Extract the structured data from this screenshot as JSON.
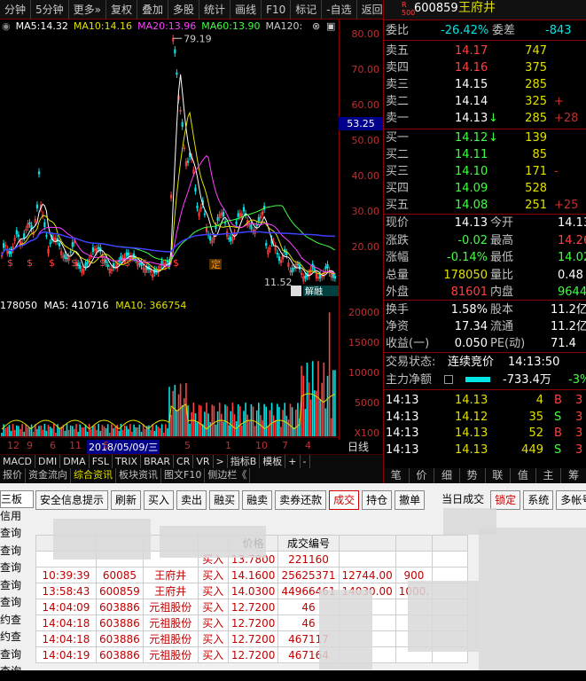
{
  "toolbar": [
    "分钟",
    "5分钟",
    "更多»",
    "复权",
    "叠加",
    "多股",
    "统计",
    "画线",
    "F10",
    "标记",
    "-自选",
    "返回"
  ],
  "ma": [
    {
      "label": "MA5:",
      "value": "14.32",
      "color": "#ffffff"
    },
    {
      "label": "MA10:",
      "value": "14.16",
      "color": "#e0e000"
    },
    {
      "label": "MA20:",
      "value": "13.96",
      "color": "#ff40ff"
    },
    {
      "label": "MA60:",
      "value": "13.90",
      "color": "#40ff40"
    },
    {
      "label": "MA120:",
      "value": "",
      "color": "#cccccc"
    }
  ],
  "price_axis": [
    "80.00",
    "70.00",
    "60.00",
    "50.00",
    "40.00",
    "30.00",
    "20.00"
  ],
  "cursor_price": "53.25",
  "annotations": {
    "high": "79.19",
    "low": "11.52",
    "ding": "定",
    "jiejin": "解",
    "rong": "融"
  },
  "volume_row": {
    "prefix": "178050",
    "ma5": "MA5: 410716",
    "ma10": "MA10: 366754"
  },
  "vol_axis": [
    "20000",
    "15000",
    "10000",
    "5000",
    "X100"
  ],
  "dates": [
    "12",
    "9",
    "6",
    "11",
    "2018/05/09/三",
    "6",
    "5",
    "1",
    "10",
    "7",
    "4"
  ],
  "date_label": "日线",
  "indicator_tabs": [
    "MACD",
    "DMI",
    "DMA",
    "FSL",
    "TRIX",
    "BRAR",
    "CR",
    "VR",
    ">",
    "指标B",
    "模板",
    "+",
    "-"
  ],
  "lower_tabs": [
    "报价",
    "资金流向",
    "综合资讯",
    "板块资讯",
    "图文F10",
    "侧边栏《"
  ],
  "stock": {
    "code": "600859",
    "name": "王府井",
    "badge": "R\n500"
  },
  "weibi": {
    "label": "委比",
    "value": "-26.42%",
    "label2": "委差",
    "value2": "-843"
  },
  "asks": [
    {
      "label": "卖五",
      "price": "14.17",
      "vol": "747",
      "extra": ""
    },
    {
      "label": "卖四",
      "price": "14.16",
      "vol": "375",
      "extra": ""
    },
    {
      "label": "卖三",
      "price": "14.15",
      "vol": "285",
      "extra": ""
    },
    {
      "label": "卖二",
      "price": "14.14",
      "vol": "325",
      "extra": "+"
    },
    {
      "label": "卖一",
      "price": "14.13",
      "vol": "285",
      "extra": "+28"
    }
  ],
  "bids": [
    {
      "label": "买一",
      "price": "14.12",
      "vol": "139",
      "extra": ""
    },
    {
      "label": "买二",
      "price": "14.11",
      "vol": "85",
      "extra": ""
    },
    {
      "label": "买三",
      "price": "14.10",
      "vol": "171",
      "extra": "-"
    },
    {
      "label": "买四",
      "price": "14.09",
      "vol": "528",
      "extra": ""
    },
    {
      "label": "买五",
      "price": "14.08",
      "vol": "251",
      "extra": "+25"
    }
  ],
  "quote": [
    {
      "l1": "现价",
      "v1": "14.13",
      "l2": "今开",
      "v2": "14.13"
    },
    {
      "l1": "涨跌",
      "v1": "-0.02",
      "l2": "最高",
      "v2": "14.26"
    },
    {
      "l1": "涨幅",
      "v1": "-0.14%",
      "l2": "最低",
      "v2": "14.02"
    },
    {
      "l1": "总量",
      "v1": "178050",
      "l2": "量比",
      "v2": "0.48"
    },
    {
      "l1": "外盘",
      "v1": "81601",
      "l2": "内盘",
      "v2": "96449"
    }
  ],
  "fundamentals": [
    {
      "l1": "换手",
      "v1": "1.58%",
      "l2": "股本",
      "v2": "11.2亿"
    },
    {
      "l1": "净资",
      "v1": "17.34",
      "l2": "流通",
      "v2": "11.2亿"
    },
    {
      "l1": "收益(一)",
      "v1": "0.050",
      "l2": "PE(动)",
      "v2": "71.4"
    }
  ],
  "status": {
    "label": "交易状态:",
    "value": "连续竞价",
    "time": "14:13:50"
  },
  "main_flow": {
    "label": "主力净额",
    "value": "-733.4万",
    "pct": "-3%"
  },
  "ticks": [
    {
      "time": "14:13",
      "price": "14.13",
      "vol": "4",
      "dir": "B",
      "extra": "3"
    },
    {
      "time": "14:13",
      "price": "14.12",
      "vol": "35",
      "dir": "S",
      "extra": "3"
    },
    {
      "time": "14:13",
      "price": "14.13",
      "vol": "52",
      "dir": "B",
      "extra": "3"
    },
    {
      "time": "14:13",
      "price": "14.13",
      "vol": "449",
      "dir": "S",
      "extra": "3"
    }
  ],
  "right_tabs": [
    "笔",
    "价",
    "细",
    "势",
    "联",
    "值",
    "主",
    "筹"
  ],
  "trade_buttons": [
    "安全信息提示",
    "刷新",
    "买入",
    "卖出",
    "融买",
    "融卖",
    "卖券还款",
    "成交",
    "持仓",
    "撤单",
    "当日成交",
    "锁定",
    "系统",
    "多帐号"
  ],
  "sidebar": [
    "三板",
    "信用",
    "查询",
    "查询",
    "查询",
    "查询",
    "查询",
    "约查",
    "约查",
    "查询",
    "查询"
  ],
  "table_headers": [
    "",
    "",
    "",
    "",
    "价格",
    "成交编号",
    "",
    "",
    ""
  ],
  "trades": [
    {
      "time": "",
      "code": "",
      "name": "",
      "side": "买入",
      "price": "13.7800",
      "id": "221160",
      "amount": "",
      "qty": "",
      "x": ""
    },
    {
      "time": "10:39:39",
      "code": "60085",
      "name": "王府井",
      "side": "买入",
      "price": "14.1600",
      "id": "25625371",
      "amount": "12744.00",
      "qty": "900",
      "x": ""
    },
    {
      "time": "13:58:43",
      "code": "600859",
      "name": "王府井",
      "side": "买入",
      "price": "14.0300",
      "id": "44966461",
      "amount": "14030.00",
      "qty": "1000.",
      "x": ""
    },
    {
      "time": "14:04:09",
      "code": "603886",
      "name": "元祖股份",
      "side": "买入",
      "price": "12.7200",
      "id": "46",
      "amount": "",
      "qty": "",
      "x": ""
    },
    {
      "time": "14:04:18",
      "code": "603886",
      "name": "元祖股份",
      "side": "买入",
      "price": "12.7200",
      "id": "46",
      "amount": "",
      "qty": "",
      "x": ""
    },
    {
      "time": "14:04:18",
      "code": "603886",
      "name": "元祖股份",
      "side": "买入",
      "price": "12.7200",
      "id": "467117",
      "amount": "",
      "qty": "",
      "x": ""
    },
    {
      "time": "14:04:19",
      "code": "603886",
      "name": "元祖股份",
      "side": "买入",
      "price": "12.7200",
      "id": "467164",
      "amount": "",
      "qty": "",
      "x": ""
    }
  ]
}
